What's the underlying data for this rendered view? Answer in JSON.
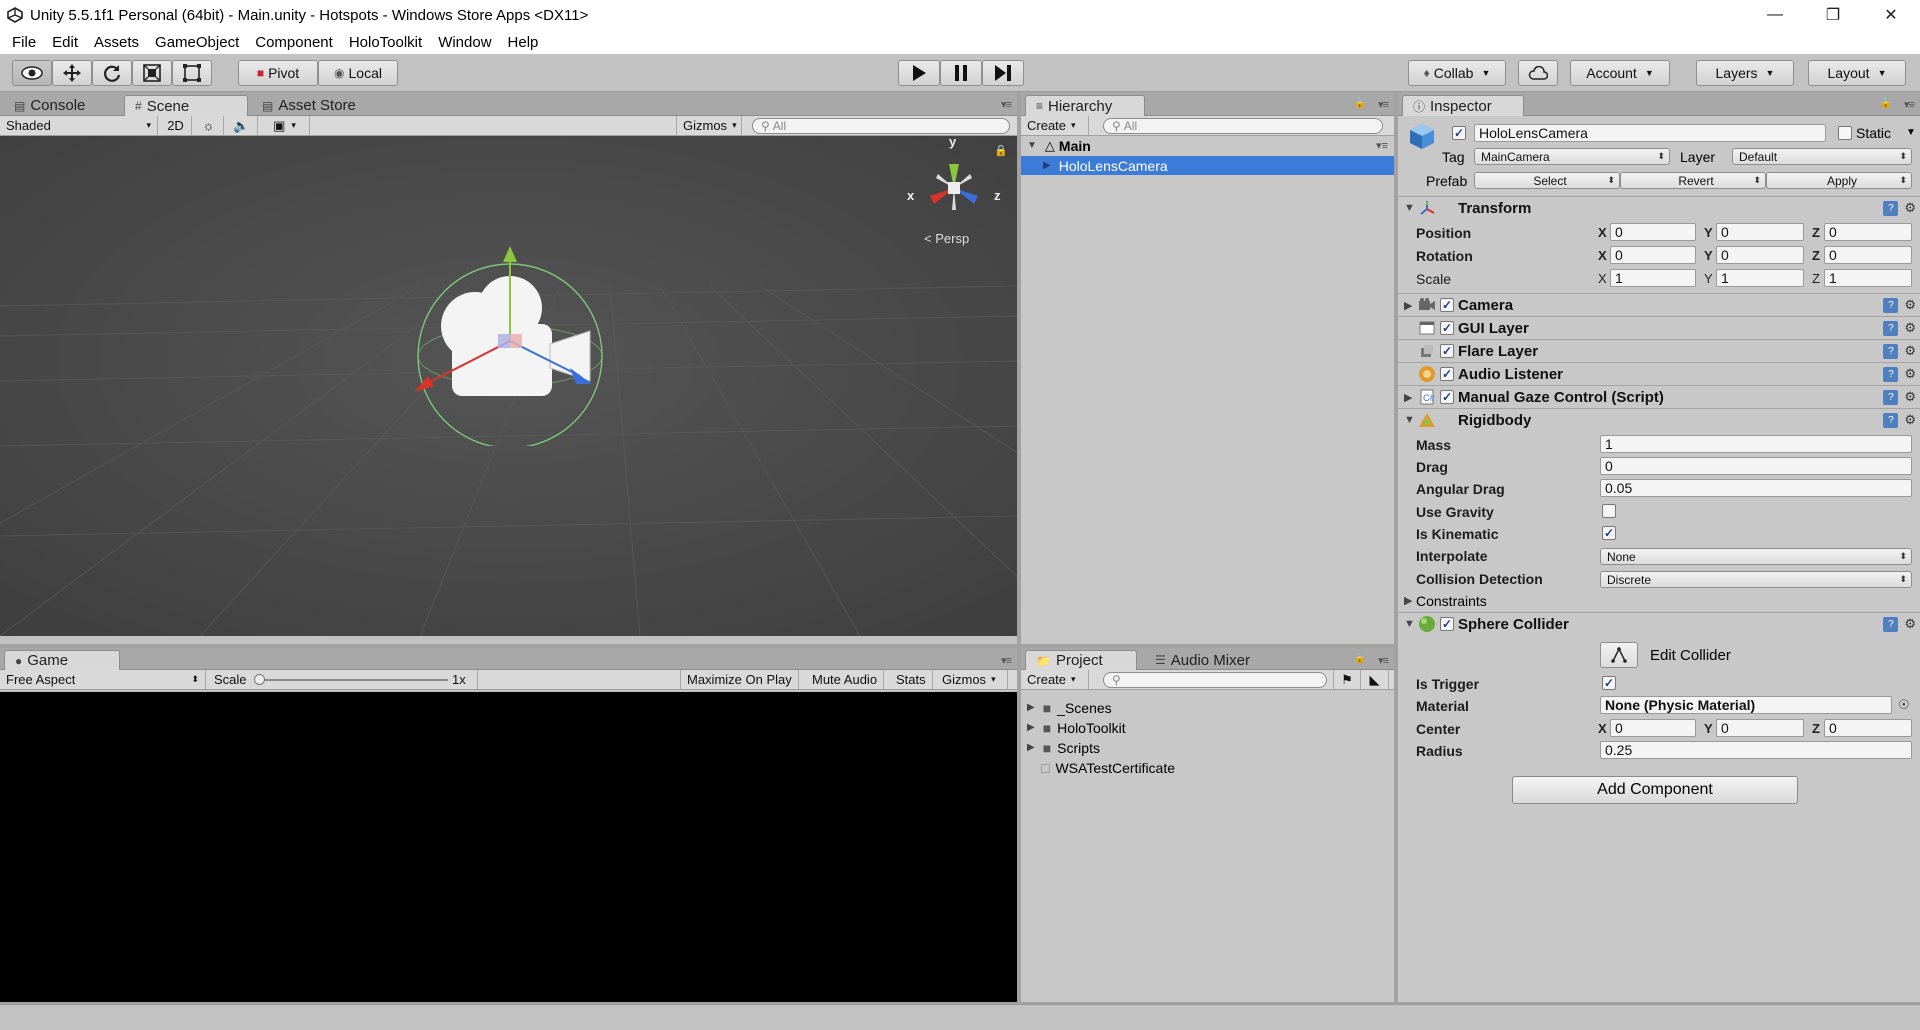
{
  "title_bar": {
    "text": "Unity 5.5.1f1 Personal (64bit) - Main.unity - Hotspots - Windows Store Apps <DX11>"
  },
  "menu": [
    "File",
    "Edit",
    "Assets",
    "GameObject",
    "Component",
    "HoloToolkit",
    "Window",
    "Help"
  ],
  "toolbar": {
    "pivot": "Pivot",
    "local": "Local",
    "collab": "Collab",
    "account": "Account",
    "layers": "Layers",
    "layout": "Layout"
  },
  "scene_panel": {
    "tabs": [
      "Console",
      "Scene",
      "Asset Store"
    ],
    "shading": "Shaded",
    "mode2d": "2D",
    "gizmos": "Gizmos",
    "search": "All",
    "gizmo_labels": {
      "y": "y",
      "x": "x",
      "z": "z"
    },
    "persp": "Persp"
  },
  "game_panel": {
    "tab": "Game",
    "aspect": "Free Aspect",
    "scale_label": "Scale",
    "scale_value": "1x",
    "maximize": "Maximize On Play",
    "mute": "Mute Audio",
    "stats": "Stats",
    "gizmos": "Gizmos"
  },
  "hierarchy": {
    "tab": "Hierarchy",
    "create": "Create",
    "search": "All",
    "scene": "Main",
    "selected_item": "HoloLensCamera"
  },
  "project": {
    "tabs": [
      "Project",
      "Audio Mixer"
    ],
    "create": "Create",
    "items": [
      "_Scenes",
      "HoloToolkit",
      "Scripts",
      "WSATestCertificate"
    ]
  },
  "inspector": {
    "tab": "Inspector",
    "object_name": "HoloLensCamera",
    "static": "Static",
    "tag_label": "Tag",
    "tag": "MainCamera",
    "layer_label": "Layer",
    "layer": "Default",
    "prefab_label": "Prefab",
    "prefab_buttons": [
      "Select",
      "Revert",
      "Apply"
    ],
    "transform": {
      "title": "Transform",
      "rows": [
        {
          "label": "Position",
          "x": "0",
          "y": "0",
          "z": "0"
        },
        {
          "label": "Rotation",
          "x": "0",
          "y": "0",
          "z": "0"
        },
        {
          "label": "Scale",
          "x": "1",
          "y": "1",
          "z": "1"
        }
      ]
    },
    "components": [
      "Camera",
      "GUI Layer",
      "Flare Layer",
      "Audio Listener",
      "Manual Gaze Control (Script)"
    ],
    "rigidbody": {
      "title": "Rigidbody",
      "mass_label": "Mass",
      "mass": "1",
      "drag_label": "Drag",
      "drag": "0",
      "angular_drag_label": "Angular Drag",
      "angular_drag": "0.05",
      "use_gravity_label": "Use Gravity",
      "use_gravity": false,
      "is_kinematic_label": "Is Kinematic",
      "is_kinematic": true,
      "interpolate_label": "Interpolate",
      "interpolate": "None",
      "collision_label": "Collision Detection",
      "collision": "Discrete",
      "constraints_label": "Constraints"
    },
    "sphere_collider": {
      "title": "Sphere Collider",
      "edit_collider": "Edit Collider",
      "is_trigger_label": "Is Trigger",
      "is_trigger": true,
      "material_label": "Material",
      "material": "None (Physic Material)",
      "center_label": "Center",
      "center_x": "0",
      "center_y": "0",
      "center_z": "0",
      "radius_label": "Radius",
      "radius": "0.25"
    },
    "add_component": "Add Component"
  },
  "colors": {
    "selection": "#3d7bd9",
    "editor_bg": "#c2c2c2",
    "scene_bg": "#474747"
  }
}
